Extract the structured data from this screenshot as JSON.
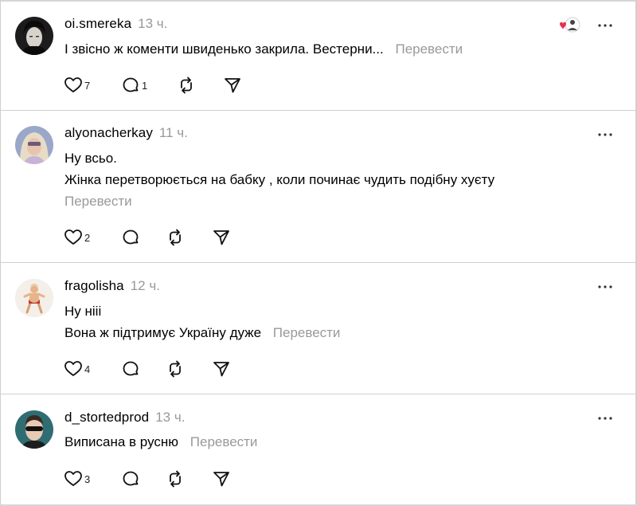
{
  "translate_label": "Перевести",
  "posts": [
    {
      "username": "oi.smereka",
      "time": "13 ч.",
      "lines": [
        "І звісно ж коменти швиденько закрила. Вестерни..."
      ],
      "likes": "7",
      "replies": "1",
      "avatar": "dark-portrait",
      "badge": "heart-reaction-icon"
    },
    {
      "username": "alyonacherkay",
      "time": "11 ч.",
      "lines": [
        "Ну всьо.",
        "Жінка перетворюється на бабку , коли починає чудить подібну хуєту"
      ],
      "likes": "2",
      "replies": "",
      "avatar": "blonde-portrait"
    },
    {
      "username": "fragolisha",
      "time": "12 ч.",
      "lines": [
        "Ну ніii",
        "Вона ж підтримує Україну дуже"
      ],
      "likes": "4",
      "replies": "",
      "avatar": "figure-illustration"
    },
    {
      "username": "d_stortedprod",
      "time": "13 ч.",
      "lines": [
        "Виписана в русню"
      ],
      "likes": "3",
      "replies": "",
      "avatar": "sunglasses-portrait"
    }
  ]
}
